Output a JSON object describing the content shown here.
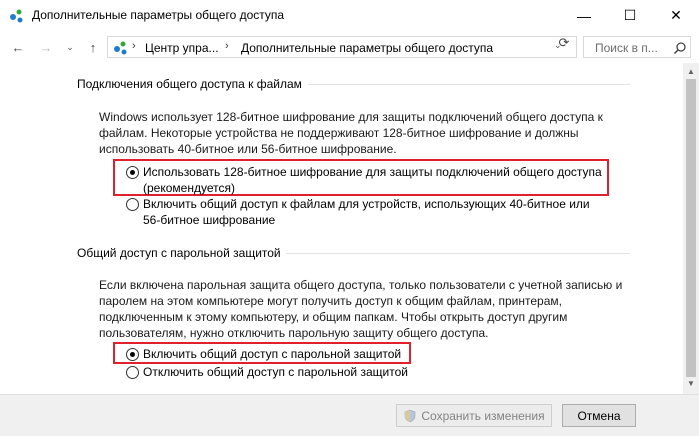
{
  "window": {
    "title": "Дополнительные параметры общего доступа",
    "minimize": "—",
    "maximize": "☐",
    "close": "✕"
  },
  "nav": {
    "back": "←",
    "forward": "→",
    "dropdown": "⌄",
    "up": "↑",
    "breadcrumb": [
      "Центр упра...",
      "Дополнительные параметры общего доступа"
    ],
    "crumb_separator": "›",
    "address_dropdown": "⌄",
    "refresh": "⟳",
    "search_placeholder": "Поиск в п..."
  },
  "sections": [
    {
      "heading": "Подключения общего доступа к файлам",
      "description": "Windows использует 128-битное шифрование для защиты подключений общего доступа к файлам. Некоторые устройства не поддерживают 128-битное шифрование и должны использовать 40-битное или 56-битное шифрование.",
      "options": [
        {
          "label_line1": "Использовать 128-битное шифрование для защиты подключений общего доступа",
          "label_line2": "(рекомендуется)",
          "selected": true,
          "highlighted": true
        },
        {
          "label_line1": "Включить общий доступ к файлам для устройств, использующих 40-битное или",
          "label_line2": "56-битное шифрование",
          "selected": false,
          "highlighted": false
        }
      ]
    },
    {
      "heading": "Общий доступ с парольной защитой",
      "description": "Если включена парольная защита общего доступа, только пользователи с учетной записью и паролем на этом компьютере могут получить доступ к общим файлам, принтерам, подключенным к этому компьютеру, и общим папкам. Чтобы открыть доступ другим пользователям, нужно отключить парольную защиту общего доступа.",
      "options": [
        {
          "label_line1": "Включить общий доступ с парольной защитой",
          "selected": true,
          "highlighted": true
        },
        {
          "label_line1": "Отключить общий доступ с парольной защитой",
          "selected": false,
          "highlighted": false
        }
      ]
    }
  ],
  "footer": {
    "save_label": "Сохранить изменения",
    "cancel_label": "Отмена"
  },
  "colors": {
    "highlight": "#e0202a",
    "footer_bg": "#f0f0f0"
  }
}
